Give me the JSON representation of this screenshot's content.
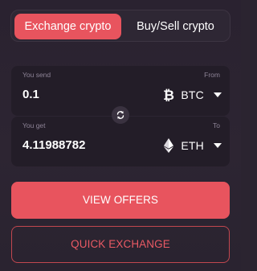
{
  "tabs": [
    {
      "label": "Exchange crypto",
      "active": true
    },
    {
      "label": "Buy/Sell crypto",
      "active": false
    }
  ],
  "send": {
    "label": "You send",
    "direction_label": "From",
    "amount": "0.1",
    "currency": {
      "code": "BTC",
      "icon": "bitcoin-icon"
    }
  },
  "get": {
    "label": "You get",
    "direction_label": "To",
    "amount": "4.11988782",
    "currency": {
      "code": "ETH",
      "icon": "ethereum-icon"
    }
  },
  "swap": {
    "icon": "swap-arrows-icon"
  },
  "buttons": {
    "view_offers": "VIEW OFFERS",
    "quick_exchange": "QUICK EXCHANGE"
  },
  "colors": {
    "accent": "#e8545e",
    "background": "#2a2230",
    "field_background": "#231d28",
    "muted_text": "#8e8497"
  }
}
